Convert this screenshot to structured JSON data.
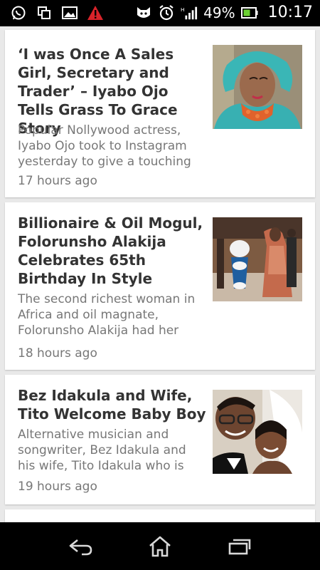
{
  "status_bar": {
    "battery_percent": "49%",
    "time": "10:17",
    "icons": [
      "whatsapp-icon",
      "screenshot-icon",
      "gallery-icon",
      "warning-icon",
      "cat-icon",
      "alarm-icon",
      "signal-icon",
      "battery-icon"
    ]
  },
  "articles": [
    {
      "title": "‘I was Once A Sales Girl, Secretary and Trader’ – Iyabo Ojo Tells Grass To Grace Story",
      "excerpt": "Popular Nollywood actress, Iyabo Ojo took to Instagram yesterday to give a touching",
      "time": "17 hours ago"
    },
    {
      "title": "Billionaire & Oil Mogul, Folorunsho Alakija Celebrates 65th Birthday In Style",
      "excerpt": "The second richest woman in Africa and oil magnate, Folorunsho Alakija had her",
      "time": "18 hours ago"
    },
    {
      "title": "Bez Idakula and Wife, Tito Welcome Baby Boy",
      "excerpt": "Alternative musician and songwriter,  Bez Idakula and his wife, Tito Idakula who is",
      "time": "19 hours ago"
    }
  ],
  "nav": {
    "buttons": [
      "back-button",
      "home-button",
      "recents-button"
    ]
  }
}
